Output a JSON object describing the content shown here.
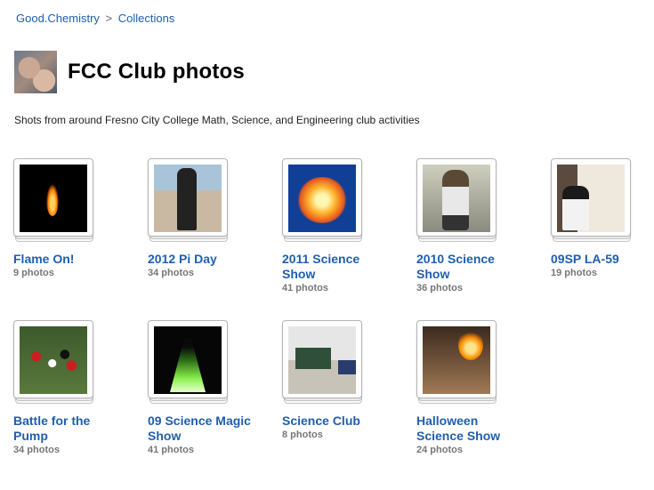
{
  "breadcrumb": {
    "user": "Good.Chemistry",
    "separator": ">",
    "section": "Collections"
  },
  "header": {
    "title": "FCC Club photos"
  },
  "description": "Shots from around Fresno City College Math, Science, and Engineering club activities",
  "collections": [
    {
      "title": "Flame On!",
      "count": "9 photos",
      "thumb": "flame"
    },
    {
      "title": "2012 Pi Day",
      "count": "34 photos",
      "thumb": "pi"
    },
    {
      "title": "2011 Science Show",
      "count": "41 photos",
      "thumb": "fire"
    },
    {
      "title": "2010 Science Show",
      "count": "36 photos",
      "thumb": "bear"
    },
    {
      "title": "09SP LA-59",
      "count": "19 photos",
      "thumb": "lab"
    },
    {
      "title": "Battle for the Pump",
      "count": "34 photos",
      "thumb": "football"
    },
    {
      "title": "09 Science Magic Show",
      "count": "41 photos",
      "thumb": "magic"
    },
    {
      "title": "Science Club",
      "count": "8 photos",
      "thumb": "class"
    },
    {
      "title": "Halloween Science Show",
      "count": "24 photos",
      "thumb": "halloween"
    }
  ]
}
